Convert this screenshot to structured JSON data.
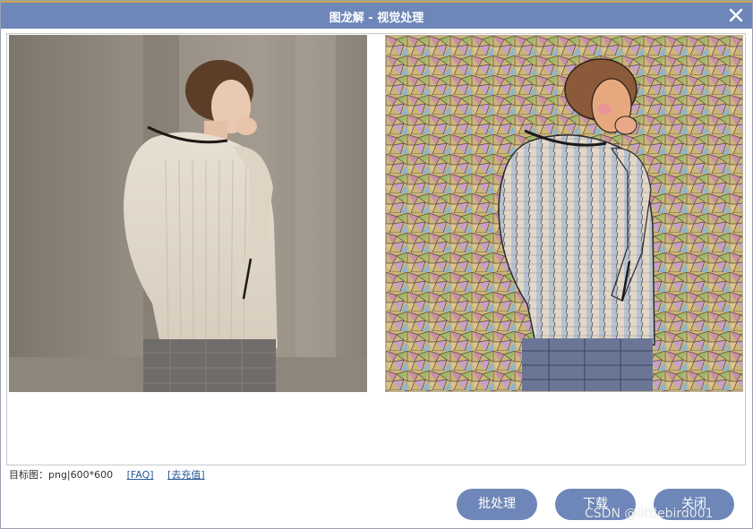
{
  "dialog": {
    "title": "图龙解 - 视觉处理",
    "close_icon": "close-icon"
  },
  "images": {
    "original": "original-photo",
    "processed": "stylized-mosaic-photo"
  },
  "info": {
    "target_label": "目标图：png|600*600",
    "faq_link": "[FAQ]",
    "recharge_link": "[去充值]"
  },
  "buttons": {
    "batch_label": "批处理",
    "download_label": "下载",
    "close_label": "关闭"
  },
  "watermark": "CSDN @littlebird001",
  "colors": {
    "accent": "#6e87b8",
    "link": "#2a5a9a"
  }
}
